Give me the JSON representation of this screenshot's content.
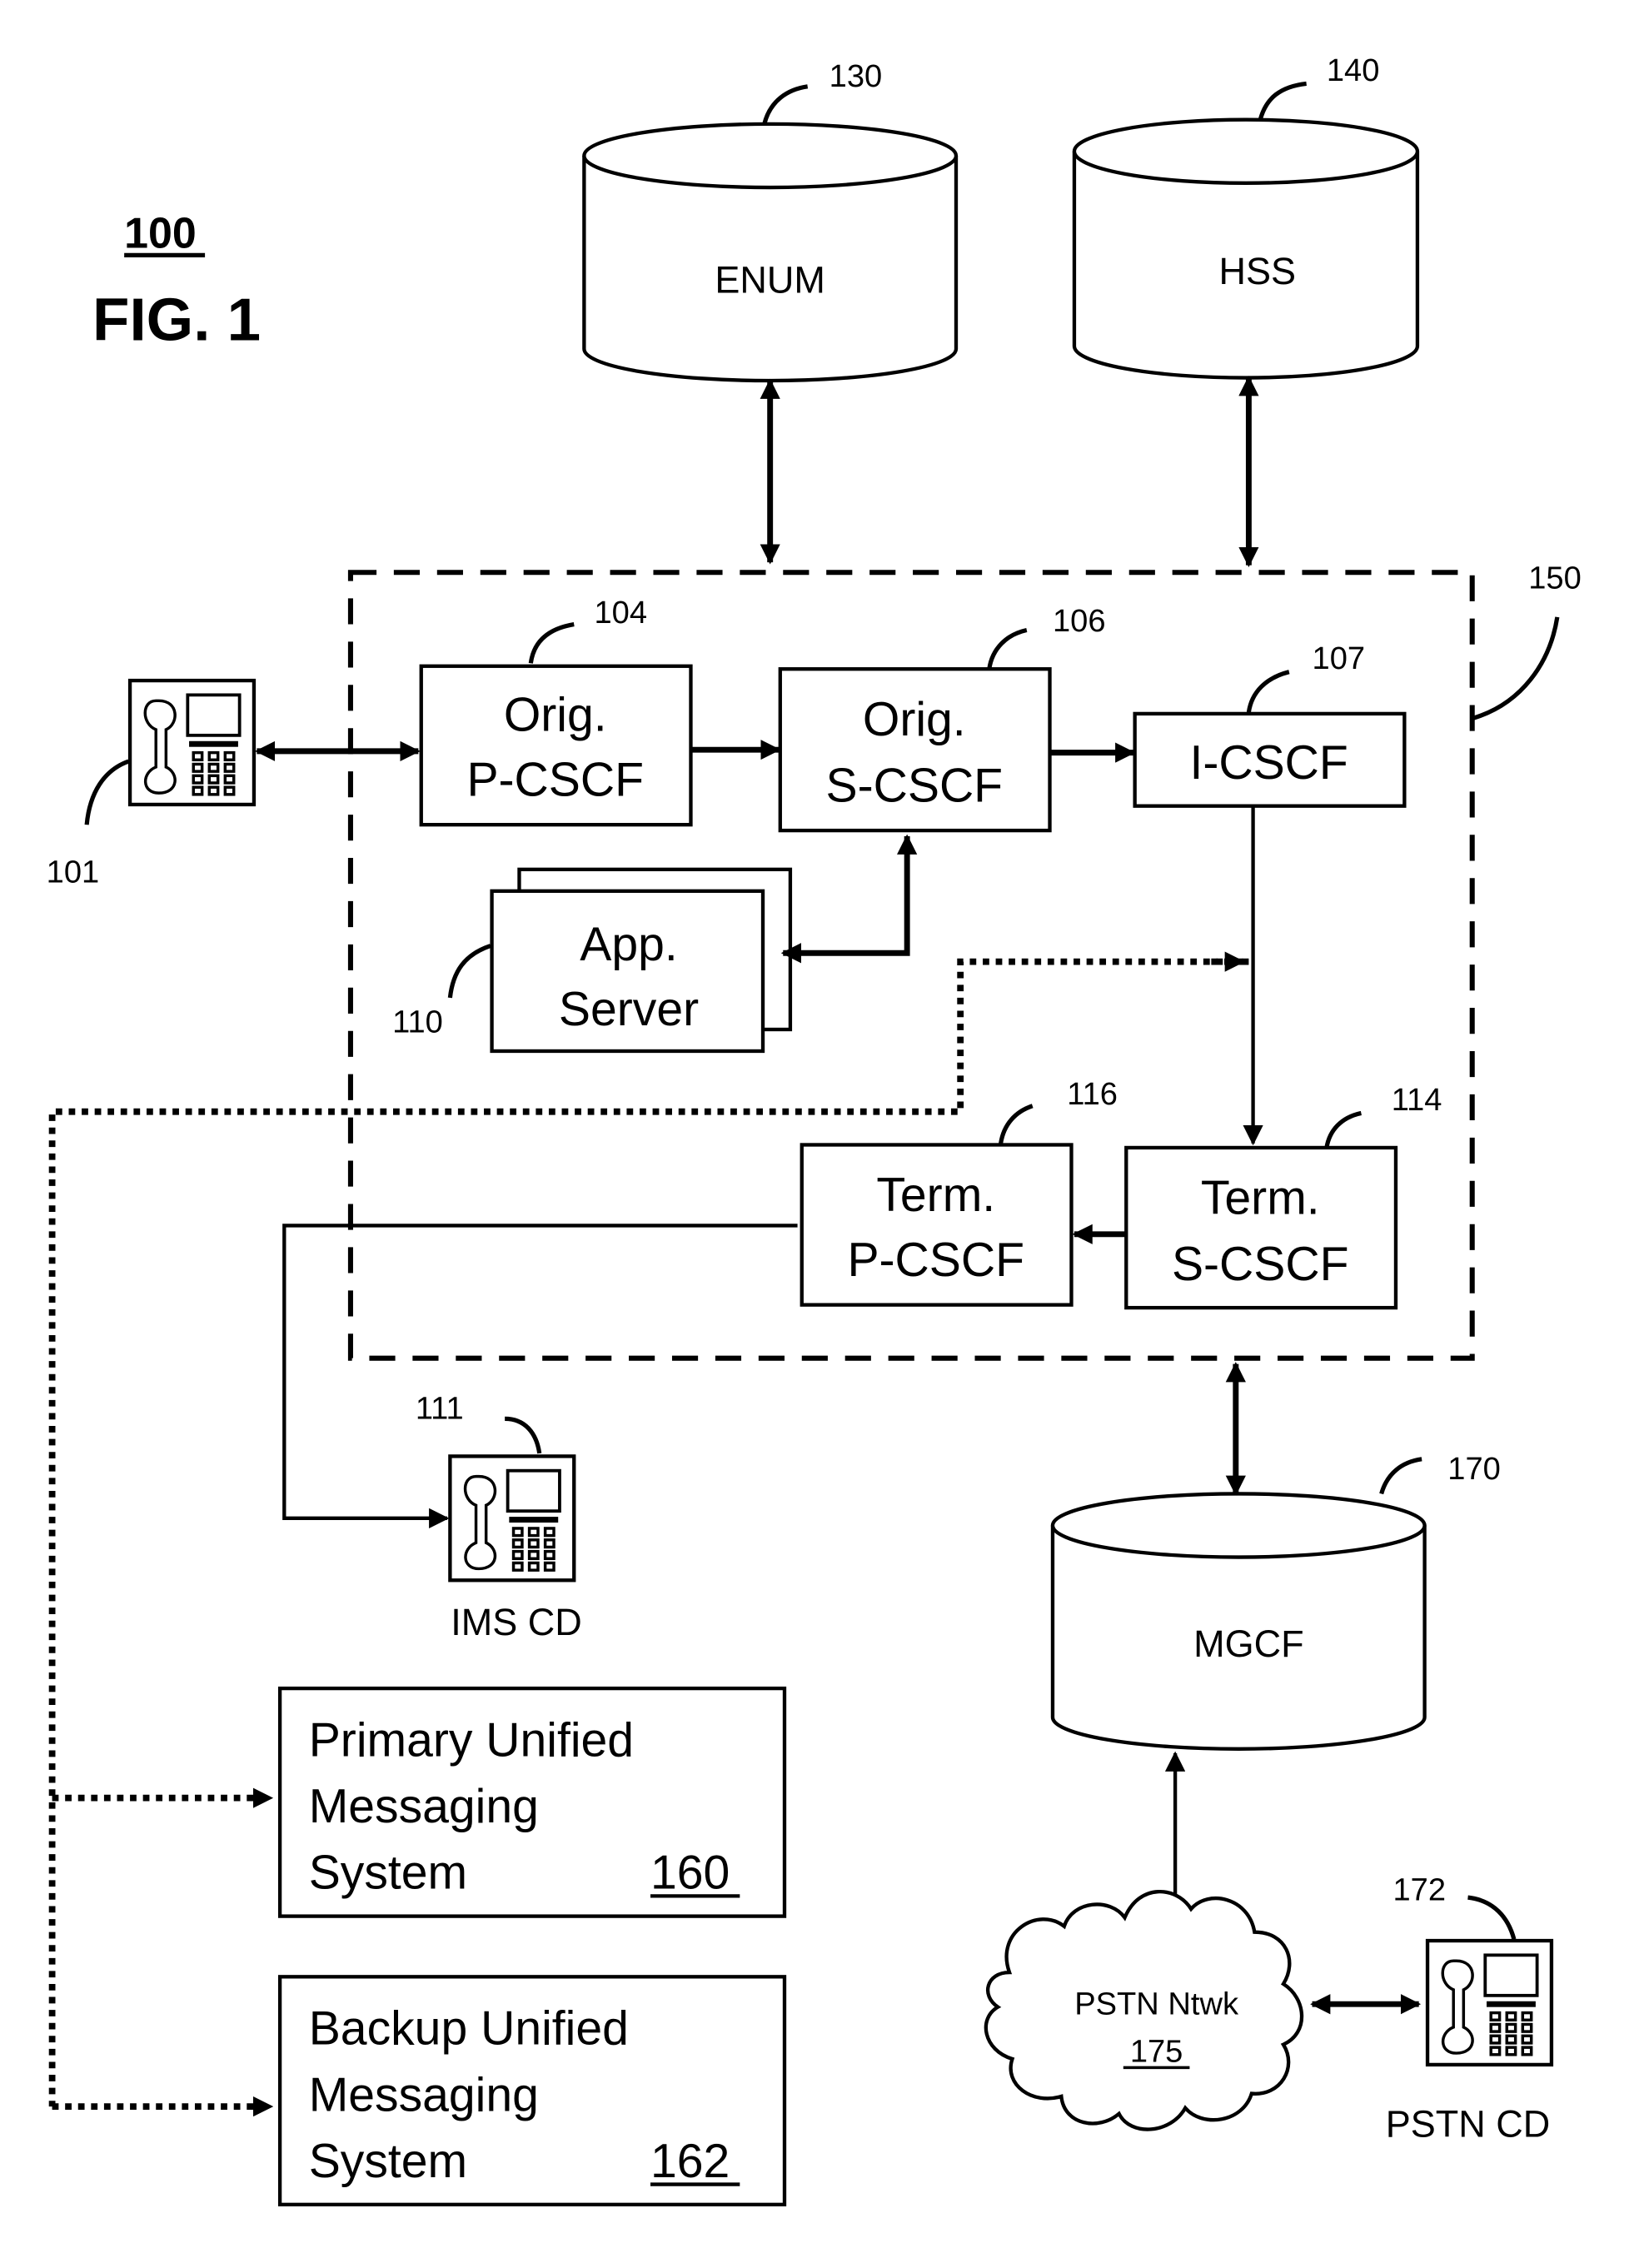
{
  "figure": {
    "ref": "100",
    "title": "FIG. 1"
  },
  "nodes": {
    "enum": {
      "label": "ENUM",
      "ref": "130"
    },
    "hss": {
      "label": "HSS",
      "ref": "140"
    },
    "ims_network": {
      "ref": "150"
    },
    "orig_pcscf": {
      "line1": "Orig.",
      "line2": "P-CSCF",
      "ref": "104"
    },
    "orig_scscf": {
      "line1": "Orig.",
      "line2": "S-CSCF",
      "ref": "106"
    },
    "icscf": {
      "label": "I-CSCF",
      "ref": "107"
    },
    "app_server": {
      "line1": "App.",
      "line2": "Server",
      "ref": "110"
    },
    "term_pcscf": {
      "line1": "Term.",
      "line2": "P-CSCF",
      "ref": "116"
    },
    "term_scscf": {
      "line1": "Term.",
      "line2": "S-CSCF",
      "ref": "114"
    },
    "calling_device": {
      "ref": "101"
    },
    "ims_cd": {
      "label": "IMS CD",
      "ref": "111"
    },
    "mgcf": {
      "label": "MGCF",
      "ref": "170"
    },
    "pstn_network": {
      "label": "PSTN Ntwk",
      "ref": "175"
    },
    "pstn_cd": {
      "label": "PSTN CD",
      "ref": "172"
    },
    "primary_ums": {
      "line1": "Primary Unified",
      "line2": "Messaging",
      "line3": "System",
      "ref": "160"
    },
    "backup_ums": {
      "line1": "Backup Unified",
      "line2": "Messaging",
      "line3": "System",
      "ref": "162"
    }
  }
}
